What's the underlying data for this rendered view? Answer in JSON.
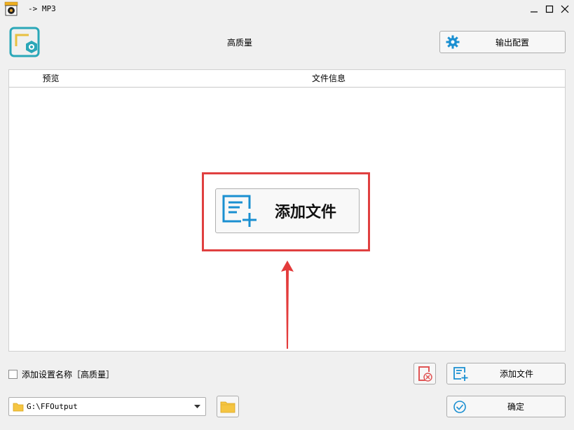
{
  "window": {
    "title": "-> MP3",
    "app_icon": "mp3-record-icon"
  },
  "header": {
    "preset_name": "高质量",
    "output_config_label": "输出配置",
    "logo_icon": "app-logo-icon",
    "gear_icon": "gear-icon"
  },
  "table": {
    "columns": [
      "预览",
      "文件信息"
    ],
    "rows": []
  },
  "center": {
    "add_files_label": "添加文件",
    "highlight_color": "#e04040"
  },
  "bottom": {
    "add_preset_name_label": "添加设置名称［高质量］",
    "add_preset_name_checked": false,
    "add_files_label": "添加文件",
    "output_folder": "G:\\FFOutput",
    "ok_label": "确定"
  },
  "colors": {
    "accent_blue": "#1a8fd1",
    "logo_teal": "#2aa7b8",
    "clear_red": "#e05555",
    "arrow_red": "#e33b3b"
  }
}
